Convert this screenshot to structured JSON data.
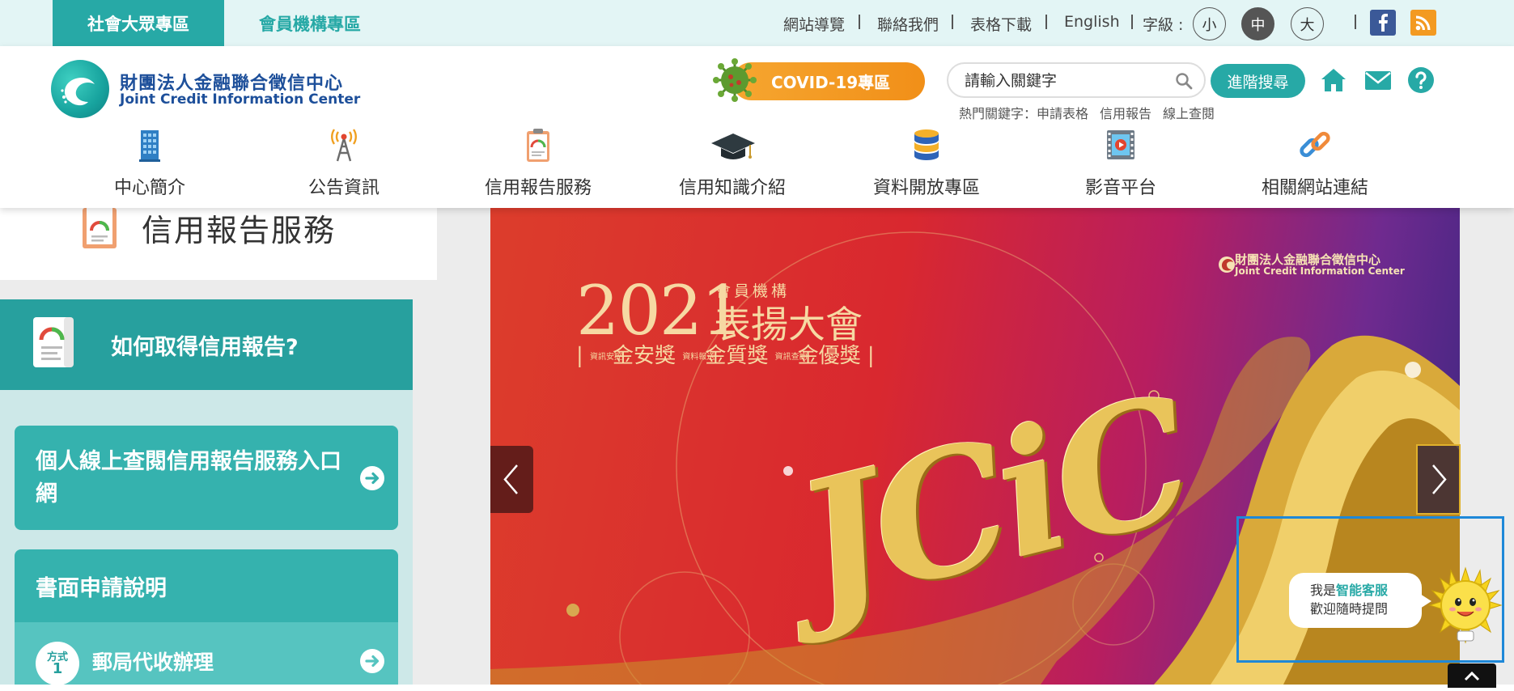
{
  "topbar": {
    "tab_public": "社會大眾專區",
    "tab_member": "會員機構專區",
    "links": [
      "網站導覽",
      "聯絡我們",
      "表格下載",
      "English"
    ],
    "font_label": "字級 :",
    "font_sizes": [
      "小",
      "中",
      "大"
    ],
    "font_size_selected": "中"
  },
  "header": {
    "logo_zh": "財團法人金融聯合徵信中心",
    "logo_en": "Joint Credit Information Center",
    "covid_label": "COVID-19專區",
    "search_placeholder": "請輸入關鍵字",
    "advanced_search": "進階搜尋",
    "hot_label": "熱門關鍵字：",
    "hot_keywords": [
      "申請表格",
      "信用報告",
      "線上查閱"
    ]
  },
  "nav": [
    {
      "label": "中心簡介",
      "icon": "building-icon"
    },
    {
      "label": "公告資訊",
      "icon": "broadcast-tower-icon"
    },
    {
      "label": "信用報告服務",
      "icon": "credit-report-clipboard-icon"
    },
    {
      "label": "信用知識介紹",
      "icon": "graduation-cap-icon"
    },
    {
      "label": "資料開放專區",
      "icon": "database-icon"
    },
    {
      "label": "影音平台",
      "icon": "video-film-icon"
    },
    {
      "label": "相關網站連結",
      "icon": "chain-link-icon"
    }
  ],
  "sidebar": {
    "section_title": "信用報告服務",
    "panel_title": "如何取得信用報告?",
    "card1_title": "個人線上查閱信用報告服務入口網",
    "card2_title": "書面申請說明",
    "method_badge_top": "方式",
    "method_badge_num": "1",
    "method_label": "郵局代收辦理"
  },
  "slide": {
    "logo_zh": "財團法人金融聯合徵信中心",
    "logo_en": "Joint Credit Information Center",
    "year": "2021",
    "subtitle": "會員機構",
    "title": "表揚大會",
    "award1_tag": "資訊安控",
    "award1": "金安獎",
    "award2_tag": "資料報送",
    "award2": "金質獎",
    "award3_tag": "資訊查詢",
    "award3": "金優獎",
    "brand": "JCiC"
  },
  "chat": {
    "line1_prefix": "我是",
    "line1_highlight": "智能客服",
    "line2": "歡迎隨時提問"
  },
  "colors": {
    "teal": "#27a9a6",
    "teal_light": "#35b2ae",
    "orange": "#f18f18",
    "logo_blue": "#1d4f9a"
  }
}
